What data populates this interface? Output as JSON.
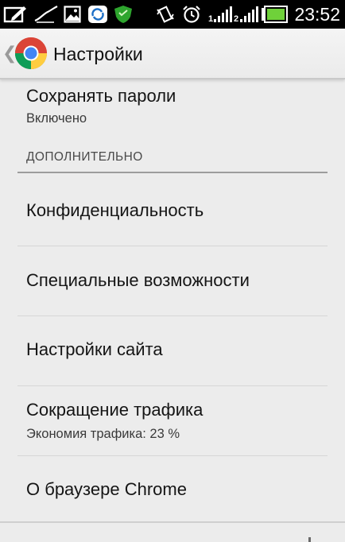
{
  "status_bar": {
    "time": "23:52",
    "icons": [
      "edit-icon",
      "signature-icon",
      "image-icon",
      "sync-icon",
      "shield-icon",
      "vibrate-icon",
      "alarm-icon",
      "signal-sim1-icon",
      "signal-sim2-icon",
      "battery-icon"
    ]
  },
  "action_bar": {
    "title": "Настройки",
    "logo": "chrome-logo"
  },
  "settings": {
    "save_passwords": {
      "title": "Сохранять пароли",
      "summary": "Включено"
    },
    "section_header": "ДОПОЛНИТЕЛЬНО",
    "privacy": {
      "title": "Конфиденциальность"
    },
    "accessibility": {
      "title": "Специальные возможности"
    },
    "site_settings": {
      "title": "Настройки сайта"
    },
    "data_saver": {
      "title": "Сокращение трафика",
      "summary": "Экономия трафика: 23 %"
    },
    "about": {
      "title": "О браузере Chrome"
    }
  },
  "colors": {
    "background": "#ececec",
    "status_bar": "#000000",
    "battery_fill": "#6fd13a",
    "shield": "#2ea52e"
  }
}
